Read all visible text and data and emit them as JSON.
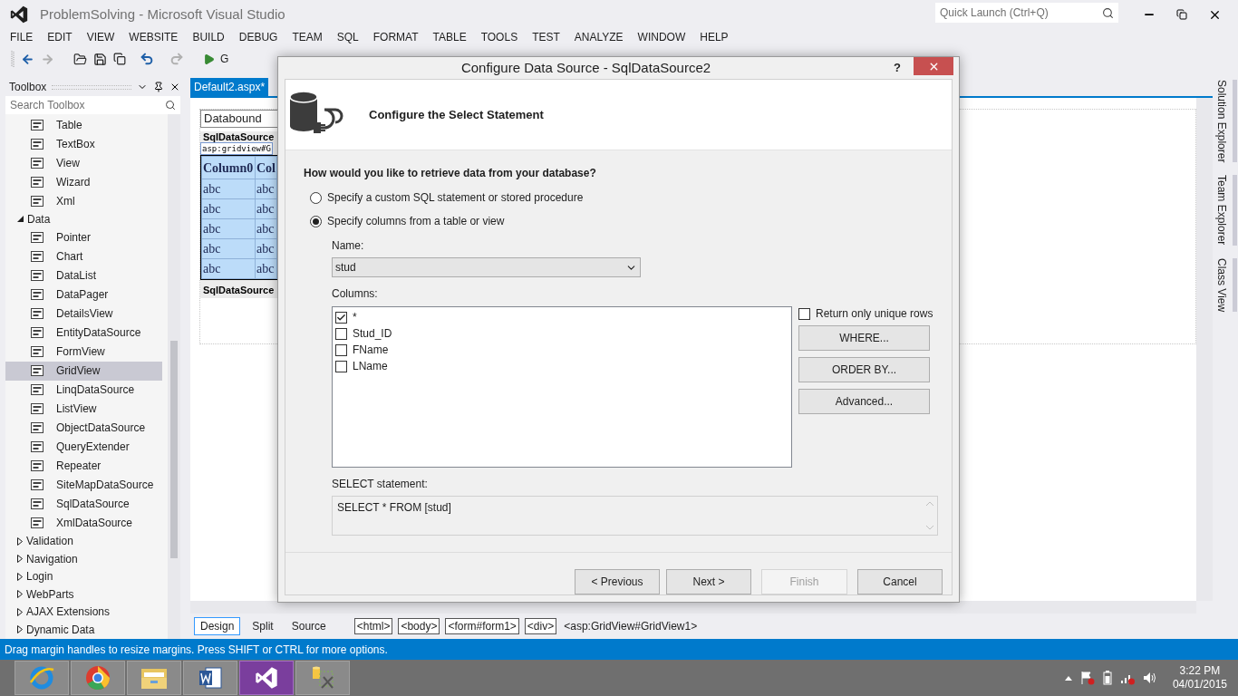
{
  "window": {
    "title": "ProblemSolving - Microsoft Visual Studio"
  },
  "quick_launch": {
    "placeholder": "Quick Launch (Ctrl+Q)"
  },
  "menu": [
    "FILE",
    "EDIT",
    "VIEW",
    "WEBSITE",
    "BUILD",
    "DEBUG",
    "TEAM",
    "SQL",
    "FORMAT",
    "TABLE",
    "TOOLS",
    "TEST",
    "ANALYZE",
    "WINDOW",
    "HELP"
  ],
  "toolbar": {
    "run_label": "G"
  },
  "toolbox": {
    "title": "Toolbox",
    "search": {
      "placeholder": "Search Toolbox"
    },
    "items": [
      {
        "kind": "tool",
        "label": "Table",
        "selected": false
      },
      {
        "kind": "tool",
        "label": "TextBox",
        "selected": false
      },
      {
        "kind": "tool",
        "label": "View",
        "selected": false
      },
      {
        "kind": "tool",
        "label": "Wizard",
        "selected": false
      },
      {
        "kind": "tool",
        "label": "Xml",
        "selected": false
      },
      {
        "kind": "group",
        "label": "Data",
        "expanded": true,
        "children": [
          {
            "kind": "tool",
            "label": "Pointer",
            "selected": false
          },
          {
            "kind": "tool",
            "label": "Chart",
            "selected": false
          },
          {
            "kind": "tool",
            "label": "DataList",
            "selected": false
          },
          {
            "kind": "tool",
            "label": "DataPager",
            "selected": false
          },
          {
            "kind": "tool",
            "label": "DetailsView",
            "selected": false
          },
          {
            "kind": "tool",
            "label": "EntityDataSource",
            "selected": false
          },
          {
            "kind": "tool",
            "label": "FormView",
            "selected": false
          },
          {
            "kind": "tool",
            "label": "GridView",
            "selected": true
          },
          {
            "kind": "tool",
            "label": "LinqDataSource",
            "selected": false
          },
          {
            "kind": "tool",
            "label": "ListView",
            "selected": false
          },
          {
            "kind": "tool",
            "label": "ObjectDataSource",
            "selected": false
          },
          {
            "kind": "tool",
            "label": "QueryExtender",
            "selected": false
          },
          {
            "kind": "tool",
            "label": "Repeater",
            "selected": false
          },
          {
            "kind": "tool",
            "label": "SiteMapDataSource",
            "selected": false
          },
          {
            "kind": "tool",
            "label": "SqlDataSource",
            "selected": false
          },
          {
            "kind": "tool",
            "label": "XmlDataSource",
            "selected": false
          }
        ]
      },
      {
        "kind": "group",
        "label": "Validation",
        "expanded": false
      },
      {
        "kind": "group",
        "label": "Navigation",
        "expanded": false
      },
      {
        "kind": "group",
        "label": "Login",
        "expanded": false
      },
      {
        "kind": "group",
        "label": "WebParts",
        "expanded": false
      },
      {
        "kind": "group",
        "label": "AJAX Extensions",
        "expanded": false
      },
      {
        "kind": "group",
        "label": "Dynamic Data",
        "expanded": false
      }
    ]
  },
  "document": {
    "tab": {
      "label": "Default2.aspx*",
      "selected": true
    },
    "dropdown_value": "Databound",
    "source_header": "SqlDataSource",
    "tag_label": "asp:gridview#G",
    "grid": {
      "columns": [
        "Column0",
        "Col"
      ],
      "rows": [
        [
          "abc",
          "abc"
        ],
        [
          "abc",
          "abc"
        ],
        [
          "abc",
          "abc"
        ],
        [
          "abc",
          "abc"
        ],
        [
          "abc",
          "abc"
        ]
      ]
    },
    "source_footer": "SqlDataSource",
    "view_tabs": [
      {
        "label": "Design",
        "selected": true
      },
      {
        "label": "Split",
        "selected": false
      },
      {
        "label": "Source",
        "selected": false
      }
    ],
    "breadcrumb": [
      {
        "label": "<html>",
        "kind": "tag"
      },
      {
        "label": "<body>",
        "kind": "tag"
      },
      {
        "label": "<form#form1>",
        "kind": "tag"
      },
      {
        "label": "<div>",
        "kind": "tag"
      },
      {
        "label": "<asp:GridView#GridView1>",
        "kind": "current"
      }
    ]
  },
  "side_tabs": [
    "Solution Explorer",
    "Team Explorer",
    "Class View"
  ],
  "dialog": {
    "title": "Configure Data Source - SqlDataSource2",
    "help": "?",
    "heading": "Configure the Select Statement",
    "question": "How would you like to retrieve data from your database?",
    "options": [
      {
        "label": "Specify a custom SQL statement or stored procedure",
        "selected": false
      },
      {
        "label": "Specify columns from a table or view",
        "selected": true
      }
    ],
    "name_label": "Name:",
    "name_value": "stud",
    "columns_label": "Columns:",
    "columns": [
      {
        "label": "*",
        "checked": true
      },
      {
        "label": "Stud_ID",
        "checked": false
      },
      {
        "label": "FName",
        "checked": false
      },
      {
        "label": "LName",
        "checked": false
      }
    ],
    "unique_rows": {
      "label": "Return only unique rows",
      "checked": false
    },
    "side_buttons": [
      "WHERE...",
      "ORDER BY...",
      "Advanced..."
    ],
    "select_label": "SELECT statement:",
    "select_value": "SELECT * FROM [stud]",
    "buttons": [
      {
        "label": "< Previous",
        "disabled": false
      },
      {
        "label": "Next >",
        "disabled": false
      },
      {
        "label": "Finish",
        "disabled": true
      },
      {
        "label": "Cancel",
        "disabled": false
      }
    ]
  },
  "status_bar": "Drag margin handles to resize margins. Press SHIFT or CTRL for more options.",
  "taskbar": {
    "apps": [
      {
        "kind": "ie",
        "selected": false
      },
      {
        "kind": "chrome",
        "selected": false
      },
      {
        "kind": "explorer",
        "selected": false
      },
      {
        "kind": "word",
        "selected": false
      },
      {
        "kind": "vs",
        "selected": true
      },
      {
        "kind": "tool",
        "selected": false
      }
    ],
    "time": "3:22 PM",
    "date": "04/01/2015"
  }
}
